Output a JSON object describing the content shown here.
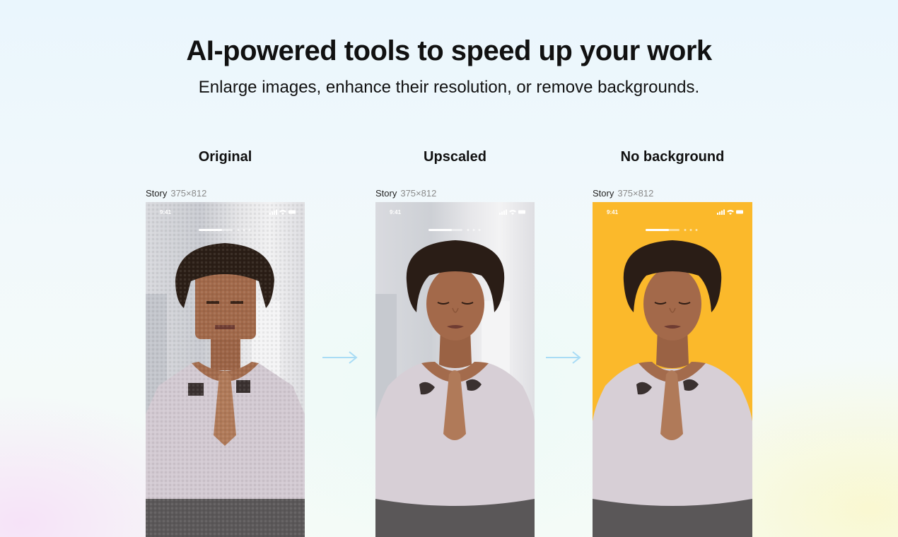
{
  "hero": {
    "title": "AI-powered tools to speed up your work",
    "subtitle": "Enlarge images, enhance their resolution, or remove backgrounds."
  },
  "columns": [
    {
      "title": "Original",
      "frame_name": "Story",
      "frame_size": "375×812",
      "status_time": "9:41",
      "background": "#d4d6db"
    },
    {
      "title": "Upscaled",
      "frame_name": "Story",
      "frame_size": "375×812",
      "status_time": "9:41",
      "background": "#d6d8dc"
    },
    {
      "title": "No background",
      "frame_name": "Story",
      "frame_size": "375×812",
      "status_time": "9:41",
      "background": "#fbb92b"
    }
  ],
  "colors": {
    "arrow": "#a9dcf5",
    "skin": "#a0694a",
    "hair": "#2a1d16",
    "shirt": "#d7cfd6",
    "pants": "#5a5758"
  },
  "icons": [
    "signal-icon",
    "wifi-icon",
    "battery-icon",
    "arrow-right-icon"
  ]
}
